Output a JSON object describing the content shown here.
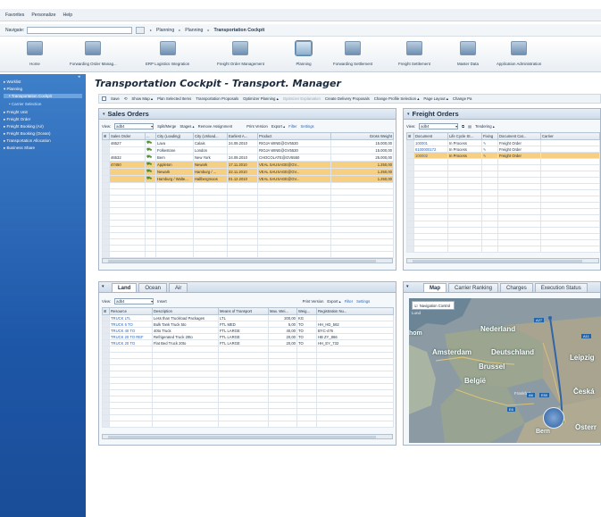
{
  "menu": {
    "items": [
      "Favorites",
      "Personalize",
      "Help"
    ]
  },
  "navigate": {
    "label": "Navigate:",
    "breadcrumb": [
      "Planning",
      "Planning",
      "Transportation Cockpit"
    ]
  },
  "launchpad": [
    {
      "label": "Home",
      "icon": "home-icon"
    },
    {
      "label": "Forwarding Order Manag...",
      "icon": "folder-icon"
    },
    {
      "label": "ERP Logistics Integration",
      "icon": "truck-icon"
    },
    {
      "label": "Freight Order Management",
      "icon": "plane-icon"
    },
    {
      "label": "Planning",
      "icon": "planning-icon"
    },
    {
      "label": "Forwarding Settlement",
      "icon": "settlement-icon"
    },
    {
      "label": "Freight Settlement",
      "icon": "freight-settlement-icon"
    },
    {
      "label": "Master Data",
      "icon": "master-data-icon"
    },
    {
      "label": "Application Administration",
      "icon": "admin-icon"
    }
  ],
  "sidebar": {
    "items": [
      {
        "label": "▸ Worklist"
      },
      {
        "label": "▾ Planning"
      },
      {
        "label": "• Transportation Cockpit"
      },
      {
        "label": "• Carrier Selection"
      },
      {
        "label": "▸ Freight Unit"
      },
      {
        "label": "▸ Freight Order"
      },
      {
        "label": "▸ Freight Booking (Air)"
      },
      {
        "label": "▸ Freight Booking (Ocean)"
      },
      {
        "label": "▸ Transportation Allocation"
      },
      {
        "label": "▸ Business Share"
      }
    ]
  },
  "page": {
    "title": "Transportation Cockpit - Transport. Manager"
  },
  "toolbar": {
    "items": [
      "Save",
      "Show Map ▴",
      "Plan Selected Items",
      "Transportation Proposals",
      "Optimizer Planning ▴",
      "Optimizer Explanation",
      "Create Delivery Proposals",
      "Change Profile Selection ▴",
      "Page Layout ▴",
      "Change Pa"
    ]
  },
  "sales_orders": {
    "title": "Sales Orders",
    "view_label": "View:",
    "view_value": "adb4",
    "actions": [
      "Split/Merge",
      "Stages ▴",
      "Remove Assignment",
      "Print Version",
      "Export ▴",
      "Filter",
      "Settings"
    ],
    "columns": [
      "Sales Order",
      "...",
      "City (Loading)",
      "City (Unload...",
      "Earliest A...",
      "Product",
      "Gross Weight"
    ],
    "rows": [
      {
        "order": "46527",
        "city_load": "Lava",
        "city_unload": "Calais",
        "date": "24.09.2010",
        "product": "RIOJA WINE@GV5530",
        "weight": "15.000,00",
        "hl": false
      },
      {
        "order": "",
        "city_load": "Folkestone",
        "city_unload": "London",
        "date": "",
        "product": "RIOJA WINE@GV5530",
        "weight": "15.000,00",
        "hl": false
      },
      {
        "order": "46532",
        "city_load": "Bern",
        "city_unload": "New York",
        "date": "24.09.2010",
        "product": "CHOCOLATE@GV5550",
        "weight": "25.000,00",
        "hl": false
      },
      {
        "order": "47450",
        "city_load": "Appleton",
        "city_unload": "Newark",
        "date": "17.11.2010",
        "product": "VEAL SAUSAGE@GV...",
        "weight": "1.250,00",
        "hl": true
      },
      {
        "order": "",
        "city_load": "Newark",
        "city_unload": "Hamburg / ...",
        "date": "22.11.2010",
        "product": "VEAL SAUSAGE@GV...",
        "weight": "1.250,00",
        "hl": true
      },
      {
        "order": "",
        "city_load": "Hamburg / Walte...",
        "city_unload": "Hallbergmoos",
        "date": "01.12.2010",
        "product": "VEAL SAUSAGE@GV...",
        "weight": "1.250,00",
        "hl": true
      }
    ]
  },
  "freight_orders": {
    "title": "Freight Orders",
    "view_label": "View:",
    "view_value": "adb4",
    "actions": [
      "Tendering ▴"
    ],
    "columns": [
      "Document",
      "Life Cycle St...",
      "Fixing",
      "Document Cat...",
      "Carrier"
    ],
    "rows": [
      {
        "doc": "100001",
        "status": "In Process",
        "cat": "Freight Order",
        "hl": false
      },
      {
        "doc": "6100000172",
        "status": "In Process",
        "cat": "Freight Order",
        "hl": false
      },
      {
        "doc": "100002",
        "status": "In Process",
        "cat": "Freight Order",
        "hl": true
      }
    ]
  },
  "resources": {
    "tabs": [
      "Land",
      "Ocean",
      "Air"
    ],
    "view_label": "View:",
    "view_value": "adb4",
    "actions": [
      "Insert",
      "Print Version",
      "Export ▴",
      "Filter",
      "Settings"
    ],
    "columns": [
      "Resource",
      "Description",
      "Means of Transport",
      "Max. Wei...",
      "Weig...",
      "Registration Nu..."
    ],
    "rows": [
      {
        "res": "TRUCK LTL",
        "desc": "Less than Truckload Packages",
        "means": "LTL",
        "max": "200,00",
        "unit": "KG",
        "reg": ""
      },
      {
        "res": "TRUCK 5 TO",
        "desc": "Bulk Tank Truck 5to",
        "means": "FTL MED",
        "max": "5,00",
        "unit": "TO",
        "reg": "HH_HD_562"
      },
      {
        "res": "TRUCK 40 TO",
        "desc": "40to Truck",
        "means": "FTL LARGE",
        "max": "40,00",
        "unit": "TO",
        "reg": "BYC-476"
      },
      {
        "res": "TRUCK 20 TO REF",
        "desc": "Refrigerated Truck 20to",
        "means": "FTL LARGE",
        "max": "20,00",
        "unit": "TO",
        "reg": "HB ZY_866"
      },
      {
        "res": "TRUCK 20 TO",
        "desc": "Flat Bed Truck 20to",
        "means": "FTL LARGE",
        "max": "20,00",
        "unit": "TO",
        "reg": "HH_EY_732"
      }
    ]
  },
  "map_panel": {
    "tabs": [
      "Map",
      "Carrier Ranking",
      "Charges",
      "Execution Status"
    ],
    "nav_control": "Navigation Control",
    "labels": {
      "nederland": "Nederland",
      "amsterdam": "Amsterdam",
      "deutschland": "Deutschland",
      "brussel": "Brussel",
      "belgie": "België",
      "leipzig": "Leipzig",
      "ceska": "Česká",
      "osterr": "Österr",
      "lund": "Lund",
      "hom": "hom",
      "bern": "Bern",
      "frankfurt": "Frankfurt",
      "a27": "A27",
      "a6": "A6",
      "e50": "E50",
      "a11": "A11",
      "e6": "E6"
    }
  }
}
